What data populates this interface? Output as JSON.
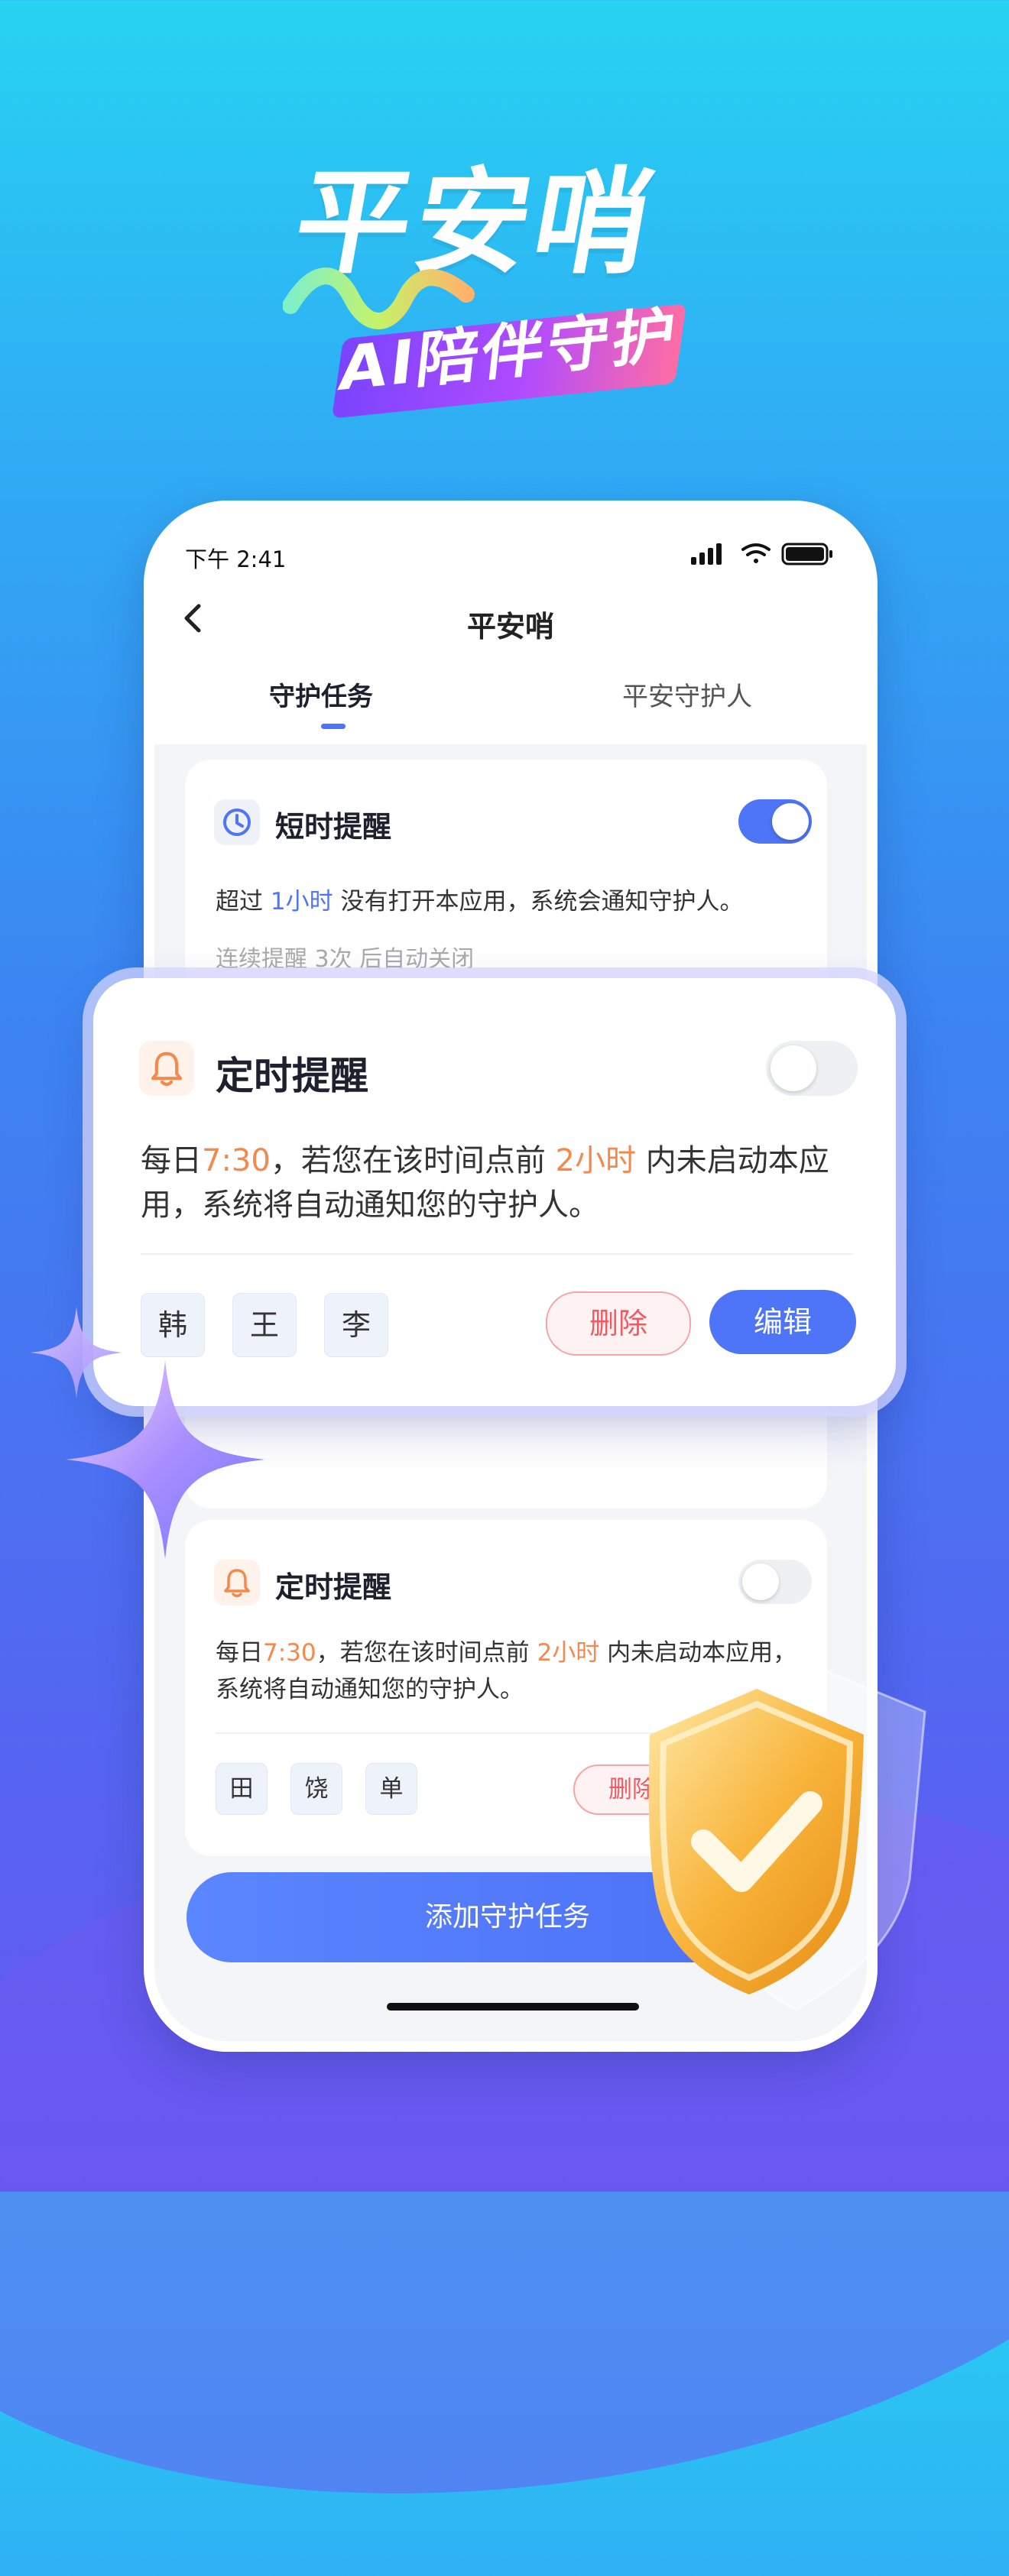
{
  "hero": {
    "title": "平安哨",
    "subtitle": "AI陪伴守护"
  },
  "status_bar": {
    "time": "下午 2:41",
    "icons": [
      "signal-icon",
      "wifi-icon",
      "battery-icon"
    ]
  },
  "nav": {
    "back_icon": "chevron-left-icon",
    "title": "平安哨"
  },
  "tabs": [
    {
      "label": "守护任务",
      "active": true
    },
    {
      "label": "平安守护人",
      "active": false
    }
  ],
  "short_reminder": {
    "icon": "clock-icon",
    "title": "短时提醒",
    "enabled": true,
    "desc_prefix": "超过 ",
    "desc_highlight": "1小时",
    "desc_suffix": " 没有打开本应用，系统会通知守护人。",
    "note": "连续提醒 3次 后自动关闭"
  },
  "timed_reminder_featured": {
    "icon": "bell-icon",
    "title": "定时提醒",
    "enabled": false,
    "desc_part1": "每日",
    "desc_time": "7:30",
    "desc_part2": "，若您在该时间点前 ",
    "desc_duration": "2小时",
    "desc_part3": " 内未启动本应用，系统将自动通知您的守护人。",
    "guardians": [
      "韩",
      "王",
      "李"
    ],
    "delete_label": "删除",
    "edit_label": "编辑"
  },
  "timed_reminder_2": {
    "icon": "bell-icon",
    "title": "定时提醒",
    "enabled": false,
    "desc_part1": "每日",
    "desc_time": "7:30",
    "desc_part2": "，若您在该时间点前 ",
    "desc_duration": "2小时",
    "desc_part3": " 内未启动本应用，系统将自动通知您的守护人。",
    "guardians": [
      "田",
      "饶",
      "单"
    ],
    "delete_label": "删除"
  },
  "add_button_label": "添加守护任务",
  "colors": {
    "accent": "#4e74f7",
    "highlight": "#f5884a",
    "danger": "#f25a63"
  }
}
